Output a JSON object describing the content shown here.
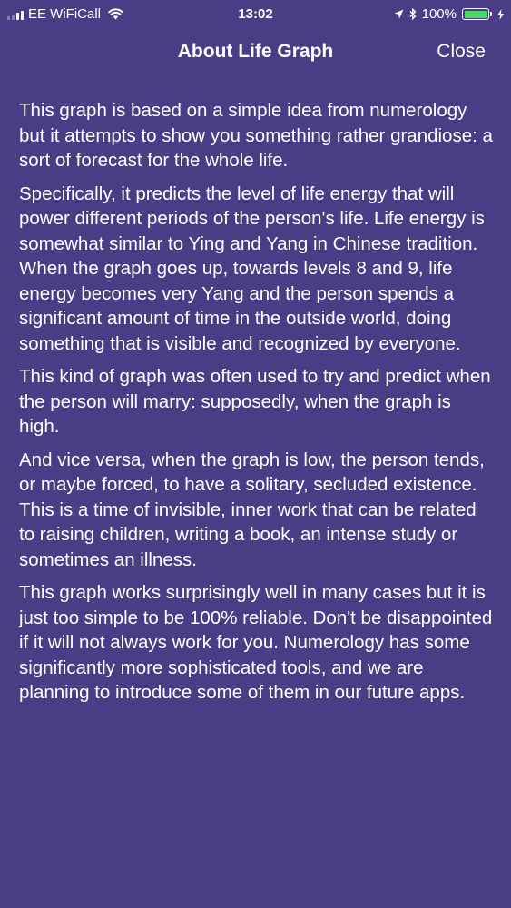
{
  "status_bar": {
    "carrier": "EE WiFiCall",
    "time": "13:02",
    "battery_percent": "100%",
    "battery_level": 1.0,
    "icons": [
      "signal-icon",
      "wifi-icon",
      "location-icon",
      "bluetooth-icon",
      "battery-icon",
      "charging-icon"
    ],
    "battery_color": "#4cd964"
  },
  "nav": {
    "title": "About Life Graph",
    "close_label": "Close"
  },
  "content": {
    "paragraphs": [
      "This graph is based on a simple idea from numerology but it attempts to show you something rather grandiose: a sort of forecast for the whole life.",
      "Specifically, it predicts the level of life energy that will power different periods of the person's life. Life energy is somewhat similar to Ying and Yang in Chinese tradition. When the graph goes up, towards levels 8 and 9, life energy becomes very Yang and the person spends a significant amount of time in the outside world, doing something that is visible and recognized by everyone.",
      "This kind of graph was often used to try and predict when the person will marry: supposedly, when the graph is high.",
      "And vice versa, when the graph is low, the person tends, or maybe forced, to have a solitary, secluded existence. This is a time of invisible, inner work that can be related to raising children, writing a book, an intense study or sometimes an illness.",
      "This graph works surprisingly well in many cases but it is just too simple to be 100% reliable. Don't be disappointed if it will not always work for you. Numerology has some significantly more sophisticated tools, and we are planning to introduce some of them in our future apps."
    ]
  },
  "colors": {
    "background": "#4a3d86",
    "text": "#ffffff"
  }
}
